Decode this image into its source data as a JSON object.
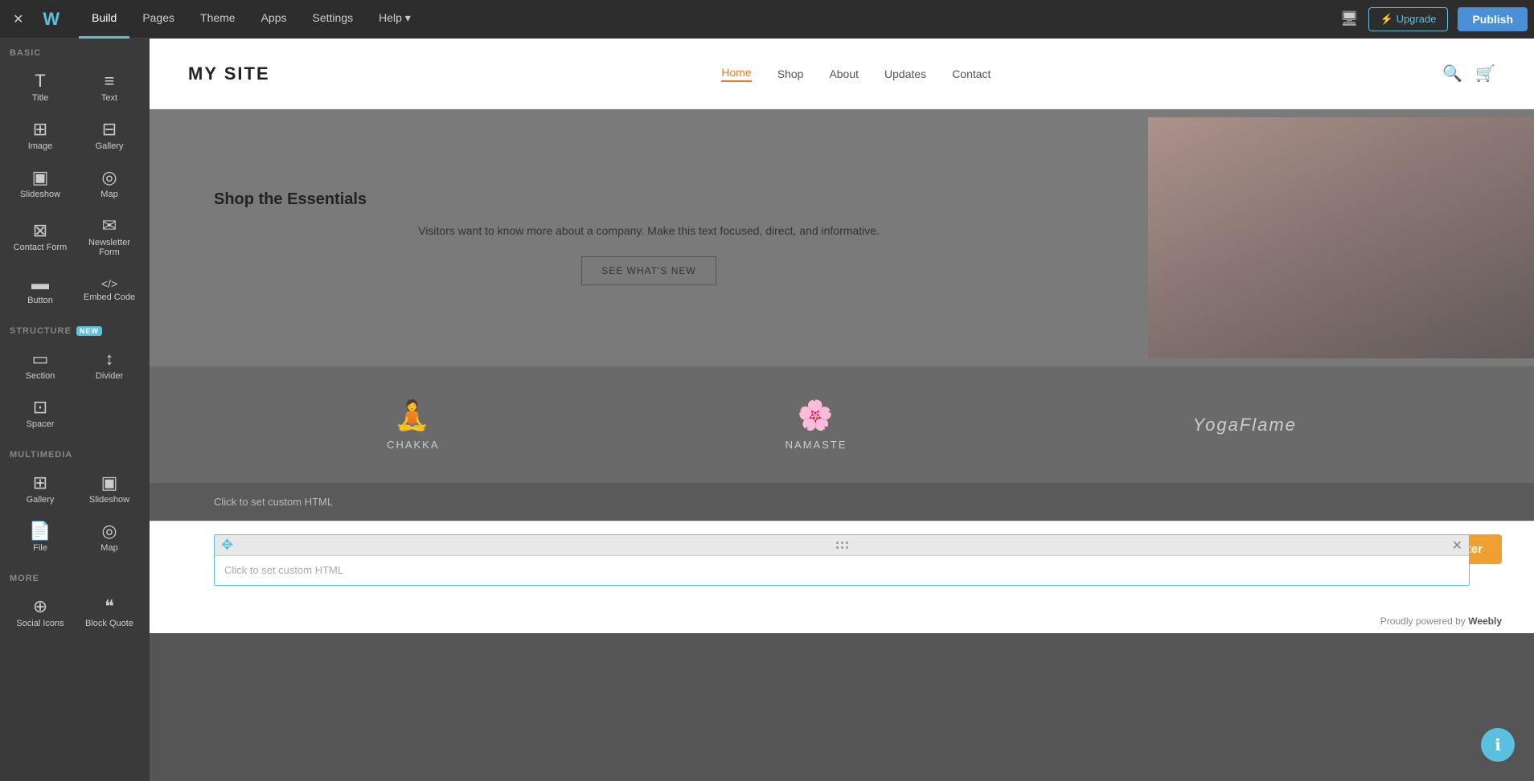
{
  "topbar": {
    "logo": "W",
    "nav_items": [
      {
        "label": "Build",
        "active": true
      },
      {
        "label": "Pages",
        "active": false
      },
      {
        "label": "Theme",
        "active": false
      },
      {
        "label": "Apps",
        "active": false
      },
      {
        "label": "Settings",
        "active": false
      },
      {
        "label": "Help ▾",
        "active": false
      }
    ],
    "upgrade_label": "⚡ Upgrade",
    "publish_label": "Publish"
  },
  "sidebar": {
    "sections": [
      {
        "label": "BASIC",
        "new_badge": false,
        "items": [
          {
            "id": "title",
            "label": "Title",
            "icon": "T"
          },
          {
            "id": "text",
            "label": "Text",
            "icon": "≡"
          },
          {
            "id": "image",
            "label": "Image",
            "icon": "⊞"
          },
          {
            "id": "gallery",
            "label": "Gallery",
            "icon": "⊟"
          },
          {
            "id": "slideshow-basic",
            "label": "Slideshow",
            "icon": "▣"
          },
          {
            "id": "map",
            "label": "Map",
            "icon": "◎"
          },
          {
            "id": "contact-form",
            "label": "Contact Form",
            "icon": "⊠"
          },
          {
            "id": "newsletter-form",
            "label": "Newsletter Form",
            "icon": "✉"
          },
          {
            "id": "button",
            "label": "Button",
            "icon": "▬"
          },
          {
            "id": "embed-code",
            "label": "Embed Code",
            "icon": "</>"
          }
        ]
      },
      {
        "label": "STRUCTURE",
        "new_badge": true,
        "items": [
          {
            "id": "section",
            "label": "Section",
            "icon": "▭"
          },
          {
            "id": "divider",
            "label": "Divider",
            "icon": "↕"
          },
          {
            "id": "spacer",
            "label": "Spacer",
            "icon": "⊡"
          }
        ]
      },
      {
        "label": "MULTIMEDIA",
        "new_badge": false,
        "items": [
          {
            "id": "gallery-mm",
            "label": "Gallery",
            "icon": "⊞"
          },
          {
            "id": "slideshow-mm",
            "label": "Slideshow",
            "icon": "▣"
          },
          {
            "id": "file",
            "label": "File",
            "icon": "📄"
          },
          {
            "id": "map-mm",
            "label": "Map",
            "icon": "◎"
          }
        ]
      },
      {
        "label": "MORE",
        "new_badge": false,
        "items": [
          {
            "id": "social-icons",
            "label": "Social Icons",
            "icon": "⊕"
          },
          {
            "id": "block-quote",
            "label": "Block Quote",
            "icon": "❝"
          }
        ]
      }
    ]
  },
  "site": {
    "logo": "MY SITE",
    "nav_items": [
      {
        "label": "Home",
        "active": true
      },
      {
        "label": "Shop",
        "active": false
      },
      {
        "label": "About",
        "active": false
      },
      {
        "label": "Updates",
        "active": false
      },
      {
        "label": "Contact",
        "active": false
      }
    ]
  },
  "shop_section": {
    "heading": "Shop the Essentials",
    "body": "Visitors want to know more about a company. Make this text focused, direct, and informative.",
    "cta_label": "SEE WHAT'S NEW"
  },
  "brands": [
    {
      "name": "CHAKKA",
      "icon": "🧘"
    },
    {
      "name": "NAMASTE",
      "icon": "🌸"
    },
    {
      "name": "YogaFlame",
      "icon": ""
    }
  ],
  "custom_html_label": "Click to set custom HTML",
  "footer": {
    "save_label": "Save Footer",
    "powered_by": "Proudly powered by ",
    "powered_link": "Weebly",
    "custom_html_label": "Click to set custom HTML"
  },
  "help_icon": "ℹ"
}
